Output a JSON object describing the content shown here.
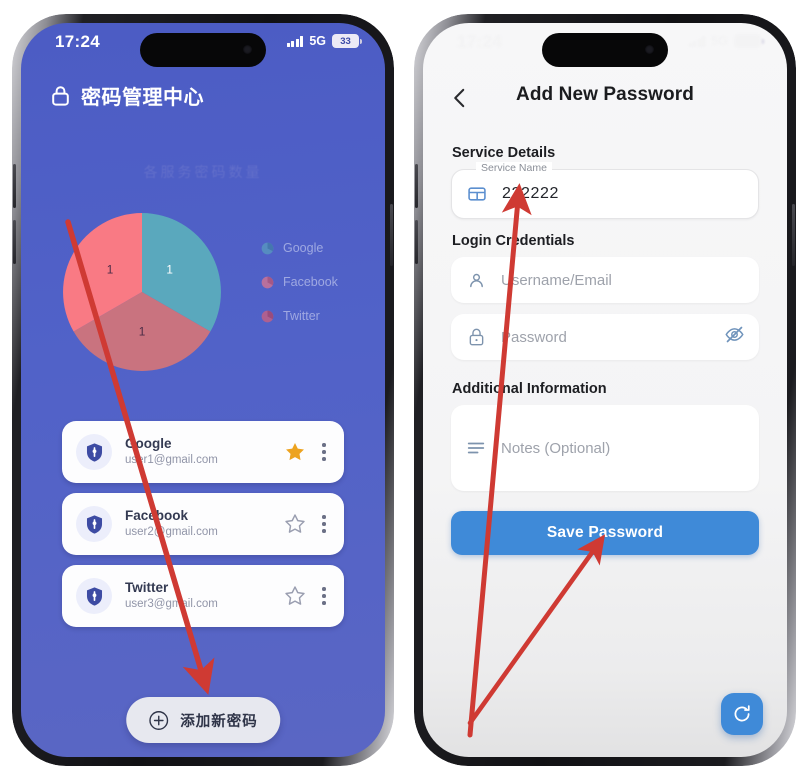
{
  "left_phone": {
    "status_bar": {
      "time": "17:24",
      "network": "5G",
      "battery": "33",
      "signal_icon": "signal-bars-icon"
    },
    "app_title": "密码管理中心",
    "lock_icon": "lock-icon",
    "chart_title": "各服务密码数量",
    "chart_data": {
      "type": "pie",
      "title": "各服务密码数量",
      "categories": [
        "Google",
        "Facebook",
        "Twitter"
      ],
      "values": [
        1,
        1,
        1
      ],
      "data_labels": [
        "1",
        "1",
        "1"
      ],
      "colors": [
        "#5aa8bd",
        "#f97a84",
        "#c9737f"
      ],
      "legend_position": "right",
      "legend": [
        "Google",
        "Facebook",
        "Twitter"
      ]
    },
    "entries": [
      {
        "service": "Google",
        "email": "user1@gmail.com",
        "favorite": true,
        "icon": "shield-icon",
        "star_icon": "star-filled-icon",
        "menu_icon": "more-vertical-icon"
      },
      {
        "service": "Facebook",
        "email": "user2@gmail.com",
        "favorite": false,
        "icon": "shield-icon",
        "star_icon": "star-outline-icon",
        "menu_icon": "more-vertical-icon"
      },
      {
        "service": "Twitter",
        "email": "user3@gmail.com",
        "favorite": false,
        "icon": "shield-icon",
        "star_icon": "star-outline-icon",
        "menu_icon": "more-vertical-icon"
      }
    ],
    "add_button": {
      "label": "添加新密码",
      "icon": "plus-circle-icon"
    }
  },
  "right_phone": {
    "status_bar": {
      "time": "17:24",
      "network": "5G",
      "battery": "33"
    },
    "nav": {
      "title": "Add New Password",
      "back_icon": "chevron-left-icon"
    },
    "sections": [
      {
        "heading": "Service Details"
      },
      {
        "heading": "Login Credentials"
      },
      {
        "heading": "Additional Information"
      }
    ],
    "service_name_field": {
      "label": "Service Name",
      "value": "222222",
      "icon": "card-icon"
    },
    "username_field": {
      "placeholder": "Username/Email",
      "value": "",
      "icon": "person-icon"
    },
    "password_field": {
      "placeholder": "Password",
      "value": "",
      "icon": "lock-icon",
      "toggle_icon": "eye-off-icon"
    },
    "notes_field": {
      "placeholder": "Notes (Optional)",
      "value": "",
      "icon": "notes-lines-icon"
    },
    "save_button": {
      "label": "Save Password"
    },
    "fab": {
      "icon": "refresh-icon"
    }
  },
  "annotations": {
    "color": "#cf3a33",
    "arrows": [
      {
        "name": "arrow-to-add-password-button"
      },
      {
        "name": "arrow-to-service-name-field"
      },
      {
        "name": "arrow-to-save-password-button"
      }
    ]
  }
}
